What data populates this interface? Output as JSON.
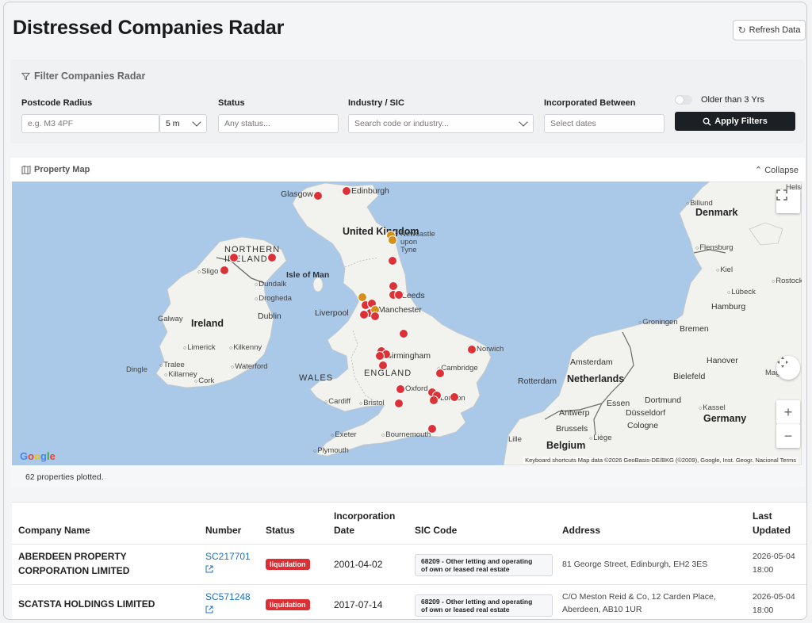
{
  "header": {
    "title": "Distressed Companies Radar",
    "refresh_label": "Refresh Data"
  },
  "filters": {
    "title": "Filter Companies Radar",
    "postcode_label": "Postcode Radius",
    "postcode_placeholder": "e.g. M3 4PF",
    "radius_value": "5 m",
    "status_label": "Status",
    "status_placeholder": "Any status...",
    "industry_label": "Industry / SIC",
    "industry_placeholder": "Search code or industry...",
    "incorporated_label": "Incorporated Between",
    "incorporated_placeholder": "Select dates",
    "older_toggle_label": "Older than 3 Yrs",
    "older_toggle_on": false,
    "apply_label": "Apply Filters"
  },
  "map": {
    "title": "Property Map",
    "collapse_label": "Collapse",
    "labels": {
      "uk": "United Kingdom",
      "ireland": "Ireland",
      "northern_ireland": "NORTHERN IRELAND",
      "isle_of_man": "Isle of Man",
      "wales": "WALES",
      "england": "ENGLAND",
      "denmark": "Denmark",
      "netherlands": "Netherlands",
      "germany": "Germany",
      "belgium": "Belgium",
      "glasgow": "Glasgow",
      "edinburgh": "Edinburgh",
      "newcastle": "Newcastle upon Tyne",
      "leeds": "Leeds",
      "liverpool": "Liverpool",
      "manchester": "Manchester",
      "birmingham": "Birmingham",
      "norwich": "Norwich",
      "cambridge": "Cambridge",
      "oxford": "Oxford",
      "london": "London",
      "cardiff": "Cardiff",
      "bristol": "Bristol",
      "exeter": "Exeter",
      "plymouth": "Plymouth",
      "bournemouth": "Bournemouth",
      "dublin": "Dublin",
      "galway": "Galway",
      "limerick": "Limerick",
      "kilkenny": "Kilkenny",
      "waterford": "Waterford",
      "cork": "Cork",
      "tralee": "Tralee",
      "killarney": "Killarney",
      "dingle": "Dingle",
      "sligo": "Sligo",
      "dundalk": "Dundalk",
      "drogheda": "Drogheda",
      "amsterdam": "Amsterdam",
      "rotterdam": "Rotterdam",
      "antwerp": "Antwerp",
      "brussels": "Brussels",
      "liege": "Liège",
      "lille": "Lille",
      "essen": "Essen",
      "dortmund": "Dortmund",
      "dusseldorf": "Düsseldorf",
      "cologne": "Cologne",
      "kassel": "Kassel",
      "bielefeld": "Bielefeld",
      "hanover": "Hanover",
      "bremen": "Bremen",
      "hamburg": "Hamburg",
      "groningen": "Groningen",
      "flensburg": "Flensburg",
      "kiel": "Kiel",
      "lubeck": "Lübeck",
      "rostock": "Rostock",
      "billund": "Billund",
      "magdeburg": "Magd",
      "helsingborg": "Helsi"
    },
    "google": "Google",
    "attribution": "Keyboard shortcuts   Map data ©2026 GeoBasis-DE/BKG (©2009), Google, Inst. Geogr. Nacional   Terms",
    "plotted_text": "62 properties plotted."
  },
  "table": {
    "headers": {
      "company": "Company Name",
      "number": "Number",
      "status": "Status",
      "inc_line1": "Incorporation",
      "inc_line2": "Date",
      "sic": "SIC Code",
      "address": "Address",
      "upd_line1": "Last",
      "upd_line2": "Updated"
    },
    "rows": [
      {
        "name_line1": "ABERDEEN PROPERTY",
        "name_line2": "CORPORATION LIMITED",
        "number": "SC217701",
        "status": "liquidation",
        "inc_date": "2001-04-02",
        "sic_line1": "68209 - Other letting and operating",
        "sic_line2": "of own or leased real estate",
        "address_line1": "81 George Street, Edinburgh, EH2 3ES",
        "address_line2": "",
        "updated_line1": "2026-05-04",
        "updated_line2": "18:00"
      },
      {
        "name_line1": "SCATSTA HOLDINGS LIMITED",
        "name_line2": "",
        "number": "SC571248",
        "status": "liquidation",
        "inc_date": "2017-07-14",
        "sic_line1": "68209 - Other letting and operating",
        "sic_line2": "of own or leased real estate",
        "address_line1": "C/O Meston Reid & Co, 12 Carden Place,",
        "address_line2": "Aberdeen, AB10 1UR",
        "updated_line1": "2026-05-04",
        "updated_line2": "18:00"
      }
    ]
  },
  "colors": {
    "pin_red": "#dc3237",
    "pin_amber": "#d5901c",
    "badge_red": "#dc2f34",
    "apply_bg": "#1c1f24",
    "link_blue": "#1f6fc4",
    "sea": "#aac9e8",
    "land": "#f2f2ee"
  }
}
